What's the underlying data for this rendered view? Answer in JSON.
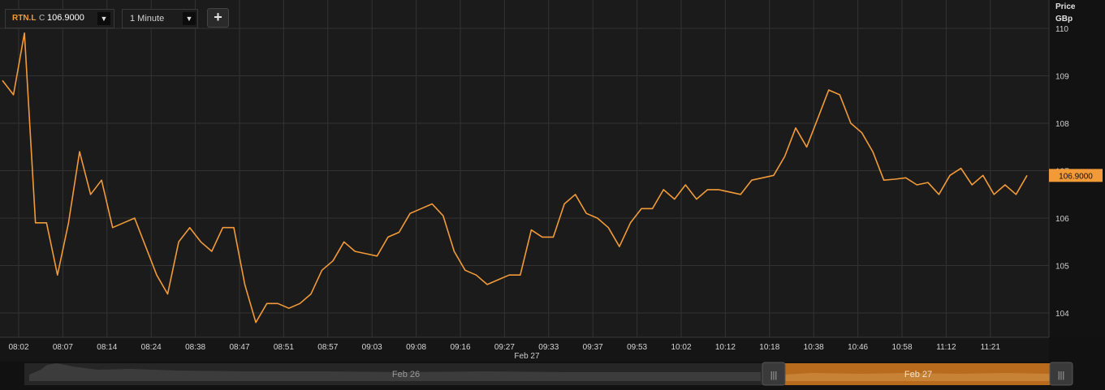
{
  "toolbar": {
    "ticker": "RTN.L",
    "price_type": "C",
    "price": "106.9000",
    "interval": "1 Minute",
    "add_label": "+"
  },
  "axis": {
    "title_line1": "Price",
    "title_line2": "GBp",
    "current_label": "106.9000",
    "date_label": "Feb 27"
  },
  "navigator": {
    "left_label": "Feb 26",
    "right_label": "Feb 27"
  },
  "colors": {
    "line": "#f29a38",
    "background": "#1b1b1b",
    "grid": "#333333"
  },
  "chart_data": {
    "type": "line",
    "x_ticks": [
      "08:02",
      "08:07",
      "08:14",
      "08:24",
      "08:38",
      "08:47",
      "08:51",
      "08:57",
      "09:03",
      "09:08",
      "09:16",
      "09:27",
      "09:33",
      "09:37",
      "09:53",
      "10:02",
      "10:12",
      "10:18",
      "10:38",
      "10:46",
      "10:58",
      "11:12",
      "11:21"
    ],
    "y_ticks": [
      104,
      105,
      106,
      107,
      108,
      109,
      110
    ],
    "ylim": [
      103.5,
      110.2
    ],
    "grid": true,
    "series": [
      {
        "values": [
          108.9,
          108.6,
          109.9,
          105.9,
          105.9,
          104.8,
          105.9,
          107.4,
          106.5,
          106.8,
          105.8,
          105.9,
          106.0,
          105.4,
          104.8,
          104.4,
          105.5,
          105.8,
          105.5,
          105.3,
          105.8,
          105.8,
          104.6,
          103.8,
          104.2,
          104.2,
          104.1,
          104.2,
          104.4,
          104.9,
          105.1,
          105.5,
          105.3,
          105.25,
          105.2,
          105.6,
          105.7,
          106.1,
          106.2,
          106.3,
          106.05,
          105.3,
          104.9,
          104.8,
          104.6,
          104.7,
          104.8,
          104.8,
          105.75,
          105.6,
          105.6,
          106.3,
          106.5,
          106.1,
          106.0,
          105.8,
          105.4,
          105.9,
          106.2,
          106.2,
          106.6,
          106.4,
          106.7,
          106.4,
          106.6,
          106.6,
          106.55,
          106.5,
          106.8,
          106.85,
          106.9,
          107.3,
          107.9,
          107.5,
          108.1,
          108.7,
          108.6,
          108.0,
          107.8,
          107.4,
          106.8,
          106.82,
          106.85,
          106.7,
          106.75,
          106.5,
          106.9,
          107.05,
          106.7,
          106.9,
          106.5,
          106.7,
          106.5,
          106.9
        ]
      }
    ]
  }
}
